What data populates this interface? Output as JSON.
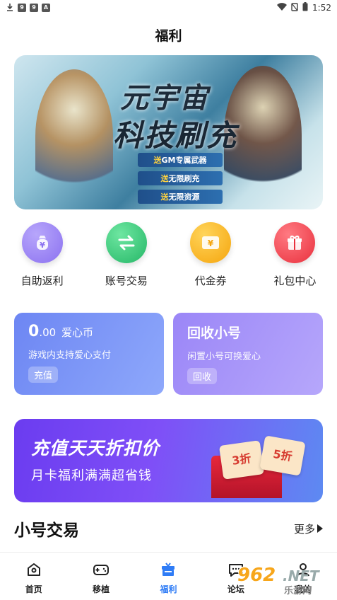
{
  "status_bar": {
    "left_icons": [
      "download-icon",
      "badge-9-icon",
      "badge-9-icon",
      "badge-a-icon"
    ],
    "time": "1:52"
  },
  "page": {
    "title": "福利"
  },
  "banner": {
    "title_line1": "元宇宙",
    "title_line2": "科技刷充",
    "tags": [
      {
        "prefix": "送",
        "text": "GM专属武器"
      },
      {
        "prefix": "送",
        "text": "无限刷充"
      },
      {
        "prefix": "送",
        "text": "无限资源"
      }
    ]
  },
  "quick_actions": [
    {
      "label": "自助返利",
      "icon": "money-bag-icon",
      "color": "#9c86f4",
      "glyph": "¥"
    },
    {
      "label": "账号交易",
      "icon": "swap-arrows-icon",
      "color": "#36c77a",
      "glyph": "⇄"
    },
    {
      "label": "代金券",
      "icon": "coupon-icon",
      "color": "#f8b319",
      "glyph": "¥"
    },
    {
      "label": "礼包中心",
      "icon": "gift-icon",
      "color": "#f0424e",
      "glyph": "🎁"
    }
  ],
  "coin_card": {
    "amount_int": "0",
    "amount_dec": ".00",
    "unit": "爱心币",
    "desc": "游戏内支持爱心支付",
    "button": "充值"
  },
  "recycle_card": {
    "title": "回收小号",
    "desc": "闲置小号可换爱心",
    "button": "回收"
  },
  "promo": {
    "title": "充值天天折扣价",
    "subtitle": "月卡福利满满超省钱",
    "tickets": [
      "3折",
      "5折"
    ]
  },
  "section": {
    "title": "小号交易",
    "more": "更多"
  },
  "tabbar": [
    {
      "label": "首页",
      "icon": "home-icon",
      "active": false
    },
    {
      "label": "移植",
      "icon": "gamepad-icon",
      "active": false
    },
    {
      "label": "福利",
      "icon": "welfare-icon",
      "active": true
    },
    {
      "label": "论坛",
      "icon": "forum-icon",
      "active": false
    },
    {
      "label": "我的",
      "icon": "profile-icon",
      "active": false
    }
  ],
  "watermark": {
    "logo": "962",
    "net": ".NET",
    "cn": "乐游网"
  },
  "colors": {
    "accent": "#2f7cf6"
  }
}
